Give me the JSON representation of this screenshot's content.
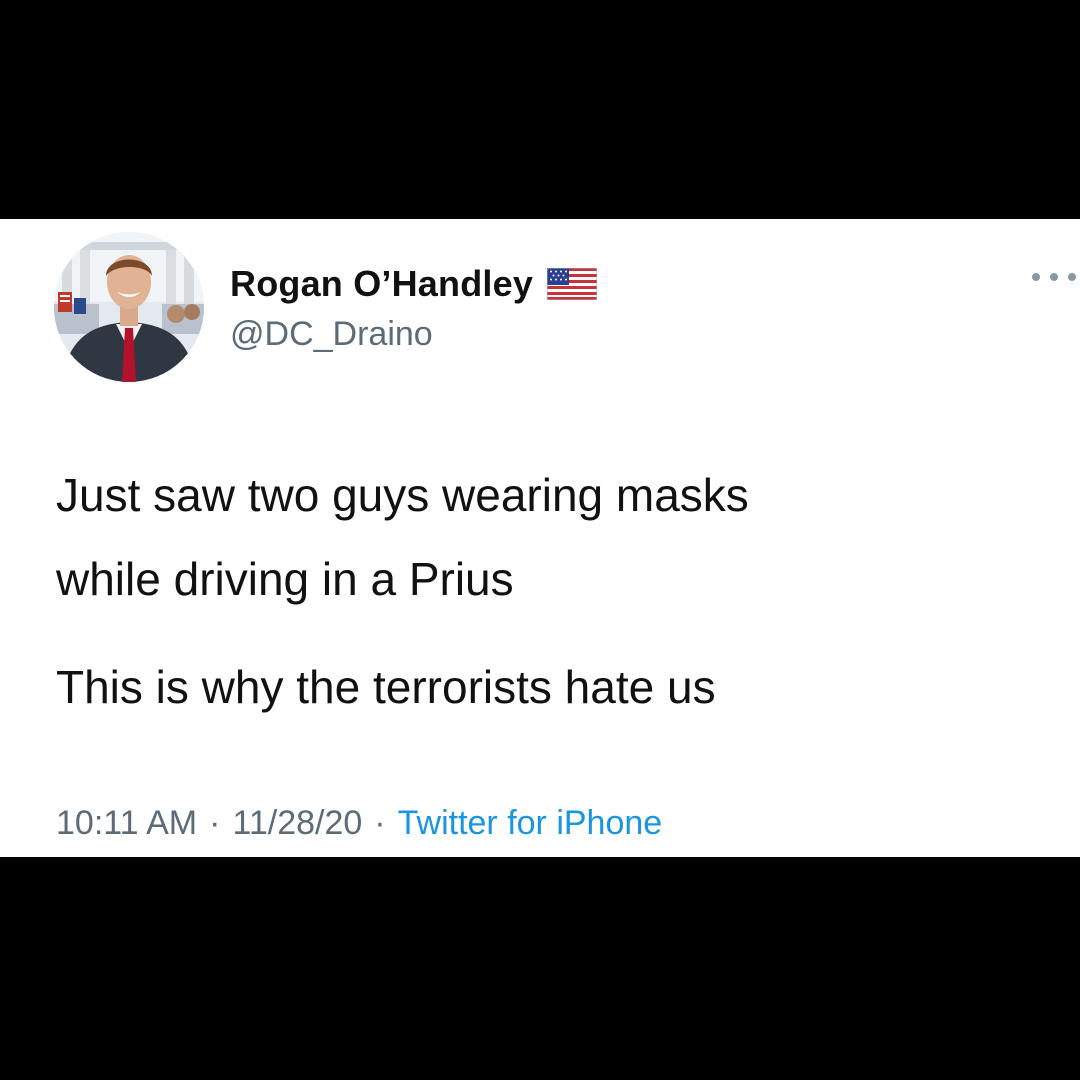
{
  "tweet": {
    "author_name": "Rogan O’Handley",
    "author_handle": "@DC_Draino",
    "lines": [
      "Just saw two guys wearing masks",
      "while driving in a Prius",
      "This is why the terrorists hate us"
    ],
    "time": "10:11 AM",
    "date": "11/28/20",
    "separator": "·",
    "source": "Twitter for iPhone"
  },
  "icons": {
    "flag": "us-flag-emoji",
    "more": "more-options-icon"
  },
  "colors": {
    "frame": "#000000",
    "card": "#ffffff",
    "text": "#111111",
    "secondary": "#5b6b78",
    "link": "#1b95e0"
  }
}
